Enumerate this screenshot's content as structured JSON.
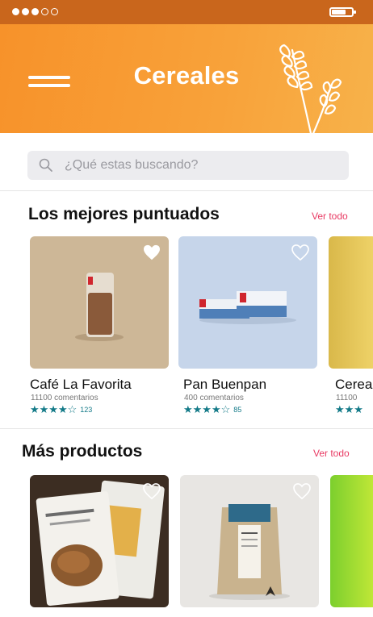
{
  "app": {
    "title": "Cereales"
  },
  "status_bar": {
    "signal_dots_filled": 3,
    "signal_dots_total": 5,
    "battery_level": 0.7
  },
  "search": {
    "placeholder": "¿Qué estas buscando?"
  },
  "sections": [
    {
      "title": "Los mejores puntuados",
      "see_all": "Ver todo",
      "products": [
        {
          "name": "Café La Favorita",
          "comments": "11100 comentarios",
          "stars": "★★★★☆",
          "rating_count": "123",
          "favorited": true,
          "image_color": "#cdb797"
        },
        {
          "name": "Pan Buenpan",
          "comments": "400 comentarios",
          "stars": "★★★★☆",
          "rating_count": "85",
          "favorited": false,
          "image_color": "#c6d5ea"
        },
        {
          "name": "Cerea",
          "comments": "11100",
          "stars": "★★★",
          "rating_count": "",
          "favorited": false,
          "image_color": "#e6c64e"
        }
      ]
    },
    {
      "title": "Más productos",
      "see_all": "Ver todo",
      "products": [
        {
          "image_color": "#3c2d22",
          "favorited": false
        },
        {
          "image_color": "#e8e6e3",
          "favorited": false
        },
        {
          "image_color": "#9bd12e",
          "favorited": false
        }
      ]
    }
  ],
  "colors": {
    "header_orange": "#f7922a",
    "status_bar": "#c9661c",
    "accent_pink": "#e83a63",
    "star_teal": "#137a88"
  }
}
